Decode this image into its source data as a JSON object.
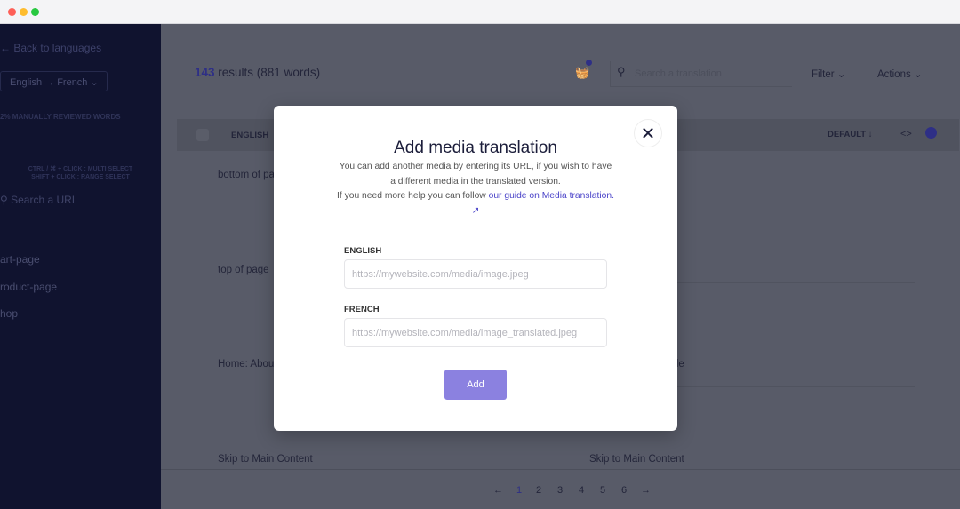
{
  "sidebar": {
    "back": "Back to languages",
    "lang_pair": "English → French",
    "reviewed": "2% MANUALLY REVIEWED WORDS",
    "hint1": "CTRL / ⌘ + CLICK : MULTI SELECT",
    "hint2": "SHIFT + CLICK : RANGE SELECT",
    "search": "Search a URL",
    "pages": [
      "art-page",
      "roduct-page",
      "hop"
    ]
  },
  "header": {
    "count": "143",
    "results": " results (881 words)",
    "search_placeholder": "Search a translation",
    "filter": "Filter",
    "actions": "Actions"
  },
  "table": {
    "col_english": "ENGLISH",
    "sort": "DEFAULT",
    "rows": [
      {
        "en": "bottom of pa",
        "fr": ""
      },
      {
        "en": "top of page",
        "fr": ""
      },
      {
        "en": "Home: Abou",
        "fr": "de"
      },
      {
        "en": "Skip to Main Content",
        "fr": "Skip to Main Content"
      }
    ]
  },
  "pagination": {
    "pages": [
      "1",
      "2",
      "3",
      "4",
      "5",
      "6"
    ],
    "current": "1"
  },
  "modal": {
    "title": "Add media translation",
    "desc1": "You can add another media by entering its URL, if you wish to have a different media in the translated version.",
    "desc2": "If you need more help you can follow ",
    "link": "our guide on Media translation.",
    "english_label": "ENGLISH",
    "english_placeholder": "https://mywebsite.com/media/image.jpeg",
    "french_label": "FRENCH",
    "french_placeholder": "https://mywebsite.com/media/image_translated.jpeg",
    "add": "Add"
  },
  "colors": {
    "accent": "#4b44c9",
    "button": "#8b81e0"
  }
}
